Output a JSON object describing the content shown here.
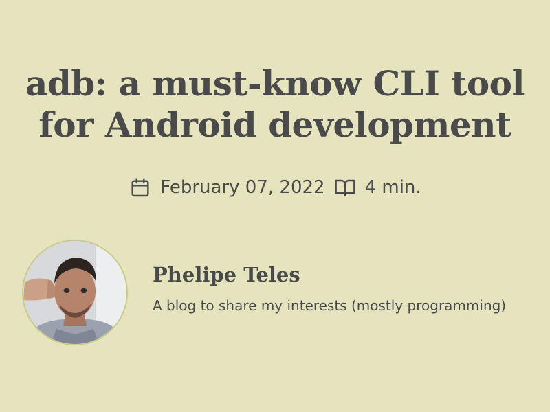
{
  "post": {
    "title": "adb: a must-know CLI tool for Android development",
    "date": "February 07, 2022",
    "reading_time": "4 min."
  },
  "author": {
    "name": "Phelipe Teles",
    "bio": "A blog to share my interests (mostly programming)"
  },
  "icons": {
    "date": "calendar-icon",
    "reading_time": "book-icon"
  },
  "colors": {
    "background": "#e5e4bf",
    "text": "#4a4a4a",
    "avatar_border": "#c9cb89"
  }
}
